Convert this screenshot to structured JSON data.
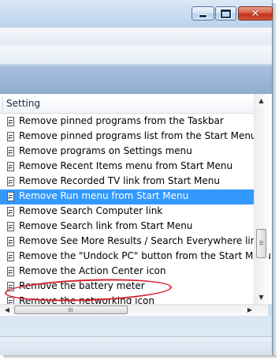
{
  "window": {
    "caption_buttons": {
      "minimize_icon": "minimize-icon",
      "maximize_icon": "maximize-icon",
      "close_icon": "close-icon",
      "close_glyph": "✕"
    }
  },
  "list": {
    "column_header": "Setting",
    "item_icon": "policy-setting-icon",
    "selected_index": 5,
    "items": [
      {
        "label": "Remove pinned programs from the Taskbar"
      },
      {
        "label": "Remove pinned programs list from the Start Menu"
      },
      {
        "label": "Remove programs on Settings menu"
      },
      {
        "label": "Remove Recent Items menu from Start Menu"
      },
      {
        "label": "Remove Recorded TV link from Start Menu"
      },
      {
        "label": "Remove Run menu from Start Menu"
      },
      {
        "label": "Remove Search Computer link"
      },
      {
        "label": "Remove Search link from Start Menu"
      },
      {
        "label": "Remove See More Results / Search Everywhere link"
      },
      {
        "label": "Remove the \"Undock PC\" button from the Start Menu"
      },
      {
        "label": "Remove the Action Center icon"
      },
      {
        "label": "Remove the battery meter"
      },
      {
        "label": "Remove the networking icon"
      }
    ]
  },
  "scrollbars": {
    "up_arrow": "▲",
    "down_arrow": "▼",
    "left_arrow": "◀",
    "right_arrow": "▶"
  },
  "colors": {
    "selection": "#3399ff",
    "annotation_oval": "#d4222b"
  }
}
